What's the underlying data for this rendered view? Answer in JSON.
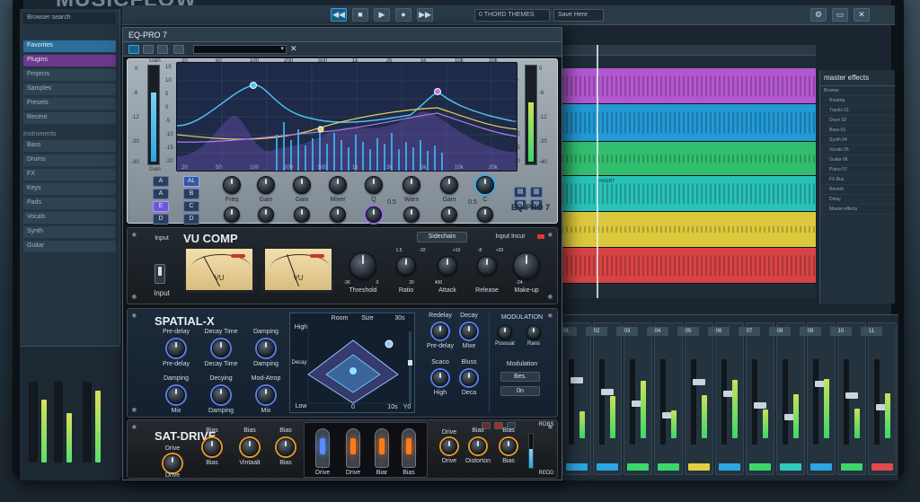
{
  "app": {
    "title": "MUSICFLOW"
  },
  "browser": {
    "search_placeholder": "Browser search",
    "items": [
      "Favorites",
      "Plugins",
      "Projects",
      "Samples",
      "Presets",
      "Recent"
    ],
    "head2": "Instruments",
    "list": [
      "Bass",
      "Drums",
      "FX",
      "Keys",
      "Pads",
      "Vocals",
      "Synth",
      "Guitar"
    ]
  },
  "toolbar": {
    "position": "0  THORD THEMES",
    "save_label": "Save Here",
    "transport": [
      "◀◀",
      "■",
      "▶",
      "●",
      "▶▶"
    ]
  },
  "eq": {
    "window_title": "EQ-PRO 7",
    "name": "EQ-PRO 7",
    "gain_label": "Gain",
    "gain_label_bottom": "Gain",
    "freq_top": [
      "20",
      "50",
      "100",
      "200",
      "500",
      "1k",
      "2k",
      "5k",
      "10k",
      "20k"
    ],
    "freq_bottom": [
      "20",
      "50",
      "100",
      "200",
      "500",
      "1k",
      "2k",
      "5k",
      "10k",
      "20k"
    ],
    "db_left": [
      "15",
      "10",
      "5",
      "0",
      "-5",
      "-10",
      "-15",
      "-20"
    ],
    "db_right": [
      "15",
      "10",
      "5",
      "0",
      "-5",
      "-10",
      "-15",
      "-20"
    ],
    "meter_scale": [
      "0",
      "-6",
      "-12",
      "-20",
      "-30"
    ],
    "meter_scale_right": [
      "0",
      "-6",
      "-12",
      "-20",
      "-40"
    ],
    "bands_left": [
      "A",
      "A",
      "E",
      "D"
    ],
    "bands_right": [
      "AL",
      "B",
      "C",
      "D"
    ],
    "knobs_top": [
      "Freq",
      "Gain",
      "Gain",
      "Mixer",
      "Q",
      "Warn",
      "Gain",
      "C"
    ],
    "knobs_bottom": [
      "Q",
      "Mat.",
      "Slope",
      "Son",
      "Q",
      "Profile",
      "Yocal",
      "Matro"
    ],
    "small_label": "0.5",
    "small_label2": "0.5"
  },
  "comp": {
    "name": "VU COMP",
    "input_label": "Input",
    "input_label_bottom": "Input",
    "sidechain": "Sidechain",
    "input_incur": "Input Incur",
    "vu1": "VU",
    "vu2": "VU",
    "knobs": [
      "Threshold",
      "Ratio",
      "Attack",
      "Release",
      "Make-up"
    ],
    "ticks": [
      "-36",
      "0",
      "1.5",
      "20",
      "-32",
      "400",
      "+10",
      "-8",
      "+20",
      "-24"
    ]
  },
  "reverb": {
    "name": "SPATIAL-X",
    "left_knobs": [
      {
        "top": "Pre-delay",
        "bottom": "Pre-delay"
      },
      {
        "top": "Decay Time",
        "bottom": "Decay Time"
      },
      {
        "top": "Damping",
        "bottom": "Damping"
      },
      {
        "top": "Damping",
        "bottom": "Mix"
      },
      {
        "top": "Decying",
        "bottom": "Damping"
      },
      {
        "top": "Mod-Atrop",
        "bottom": "Mix"
      }
    ],
    "room": "Room",
    "size": "Size",
    "size_val": "30s",
    "high": "High",
    "decay": "Decay",
    "low": "Low",
    "zero": "0",
    "ten": "10s",
    "yo": "Y0",
    "right_knobs": [
      {
        "top": "Redelay",
        "bottom": "Pre-delay"
      },
      {
        "top": "Decay",
        "bottom": "Mixe"
      },
      {
        "top": "Scaco",
        "bottom": "High"
      },
      {
        "top": "Bluss",
        "bottom": "Deca"
      }
    ],
    "modulation": "MODULATION",
    "mod_knobs": [
      "Pssouat",
      "Rans"
    ],
    "modulation2": "Modulation",
    "mod_opts": [
      "Bes.",
      "0n"
    ]
  },
  "sat": {
    "name": "SAT-DRIVE",
    "left_knobs": [
      {
        "top": "Drive",
        "bottom": "Drive"
      },
      {
        "top": "Bias",
        "bottom": "Bias"
      },
      {
        "top": "Bias",
        "bottom": "Vintaalt"
      },
      {
        "top": "Bias",
        "bottom": "Bias"
      }
    ],
    "tube_labels": [
      "Drive",
      "Drive",
      "Biar",
      "Bias"
    ],
    "right_knobs": [
      {
        "top": "Drive",
        "bottom": "Drive"
      },
      {
        "top": "Bias",
        "bottom": "Distorton"
      },
      {
        "top": "Bias",
        "bottom": "Bias"
      }
    ],
    "meter_top": "RDBS",
    "meter_bottom": "REDD"
  },
  "right_panel": {
    "title": "master effects",
    "search": "Browse",
    "items": [
      "Routing",
      "Tracks 01",
      "Drum 02",
      "Bass 03",
      "Synth 04",
      "Vocals 05",
      "Guitar 06",
      "Piano 07",
      "FX Bus",
      "Reverb",
      "Delay",
      "Master effects"
    ]
  },
  "tracks": {
    "colors": [
      "#c55ed8",
      "#27a3e0",
      "#35c77a",
      "#2fc9c0",
      "#e0d040",
      "#e04a4a"
    ],
    "clip_label": "INSERT"
  },
  "mixer": {
    "channels": [
      "01",
      "02",
      "03",
      "04",
      "05",
      "06",
      "07",
      "08",
      "09",
      "10",
      "11"
    ]
  }
}
